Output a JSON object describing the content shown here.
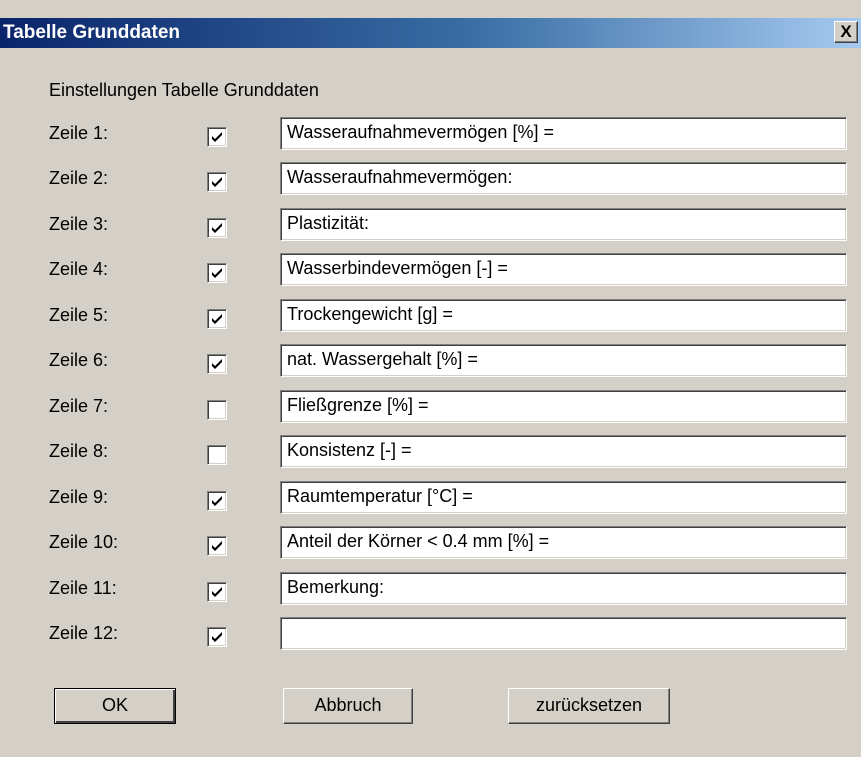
{
  "window": {
    "title": "Tabelle Grunddaten",
    "close_label": "X"
  },
  "heading": "Einstellungen Tabelle Grunddaten",
  "rows": [
    {
      "label": "Zeile 1:",
      "checked": true,
      "value": "Wasseraufnahmevermögen [%] ="
    },
    {
      "label": "Zeile 2:",
      "checked": true,
      "value": "Wasseraufnahmevermögen:"
    },
    {
      "label": "Zeile 3:",
      "checked": true,
      "value": "Plastizität:"
    },
    {
      "label": "Zeile 4:",
      "checked": true,
      "value": "Wasserbindevermögen [-] ="
    },
    {
      "label": "Zeile 5:",
      "checked": true,
      "value": "Trockengewicht [g] ="
    },
    {
      "label": "Zeile 6:",
      "checked": true,
      "value": "nat. Wassergehalt [%] ="
    },
    {
      "label": "Zeile 7:",
      "checked": false,
      "value": "Fließgrenze [%] ="
    },
    {
      "label": "Zeile 8:",
      "checked": false,
      "value": "Konsistenz [-] ="
    },
    {
      "label": "Zeile 9:",
      "checked": true,
      "value": "Raumtemperatur [°C] ="
    },
    {
      "label": "Zeile 10:",
      "checked": true,
      "value": "Anteil der Körner < 0.4 mm [%] ="
    },
    {
      "label": "Zeile 11:",
      "checked": true,
      "value": "Bemerkung:"
    },
    {
      "label": "Zeile 12:",
      "checked": true,
      "value": ""
    }
  ],
  "buttons": {
    "ok": "OK",
    "cancel": "Abbruch",
    "reset": "zurücksetzen"
  }
}
